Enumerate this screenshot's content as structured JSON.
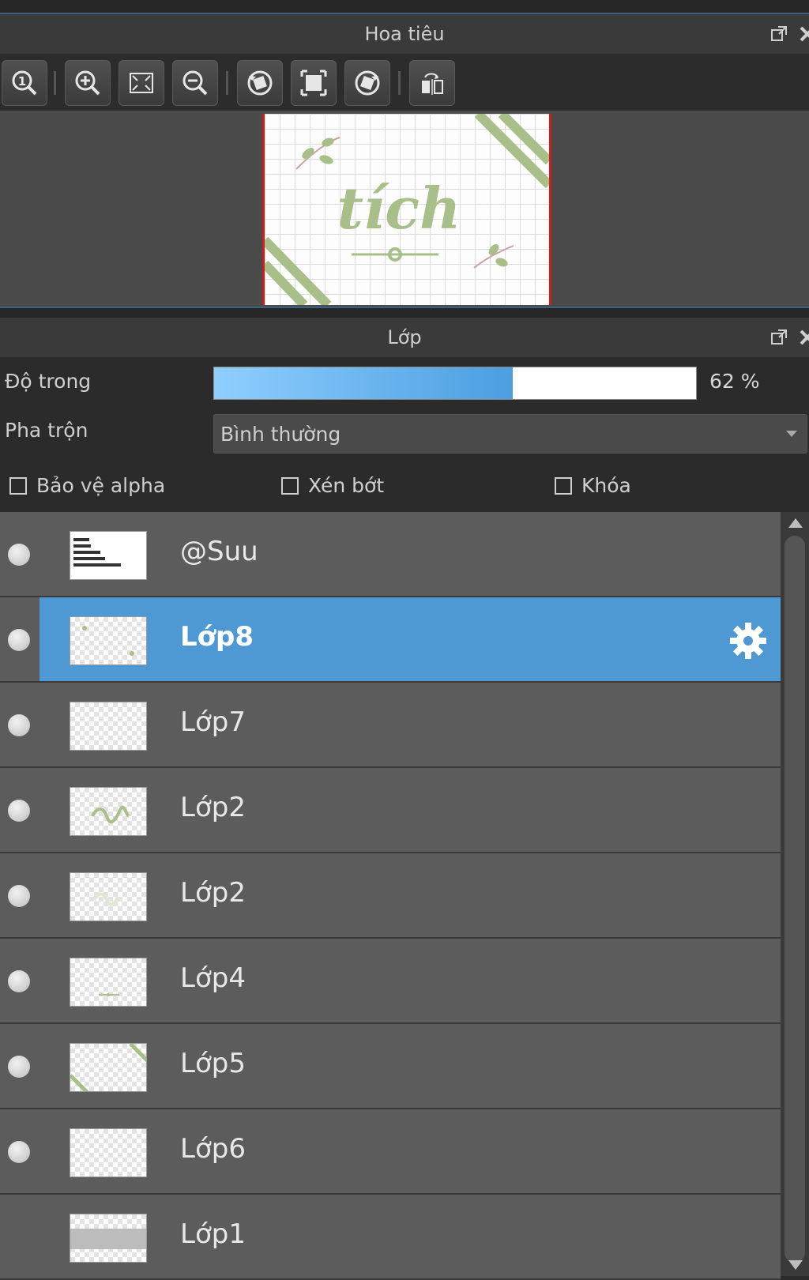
{
  "navigator": {
    "title": "Hoa tiêu",
    "toolbar": [
      {
        "name": "zoom-actual-icon"
      },
      {
        "name": "zoom-in-icon"
      },
      {
        "name": "fit-screen-icon"
      },
      {
        "name": "zoom-out-icon"
      },
      {
        "name": "rotate-left-icon"
      },
      {
        "name": "fit-canvas-icon"
      },
      {
        "name": "rotate-right-icon"
      },
      {
        "name": "flip-horizontal-icon"
      }
    ],
    "preview_text": "tích"
  },
  "layers_panel": {
    "title": "Lớp",
    "opacity_label": "Độ trong",
    "opacity_value_text": "62 %",
    "opacity_percent": 62,
    "blend_label": "Pha trộn",
    "blend_value": "Bình thường",
    "checkboxes": {
      "alpha_protect": "Bảo vệ alpha",
      "clipping": "Xén bớt",
      "lock": "Khóa"
    },
    "layers": [
      {
        "name": "@Suu",
        "selected": false
      },
      {
        "name": "Lớp8",
        "selected": true
      },
      {
        "name": "Lớp7",
        "selected": false
      },
      {
        "name": "Lớp2",
        "selected": false
      },
      {
        "name": "Lớp2",
        "selected": false
      },
      {
        "name": "Lớp4",
        "selected": false
      },
      {
        "name": "Lớp5",
        "selected": false
      },
      {
        "name": "Lớp6",
        "selected": false
      },
      {
        "name": "Lớp1",
        "selected": false
      }
    ]
  },
  "colors": {
    "selection": "#4e99d3",
    "accent_green": "#a8bf8a",
    "frame_red": "#d21b1b"
  }
}
